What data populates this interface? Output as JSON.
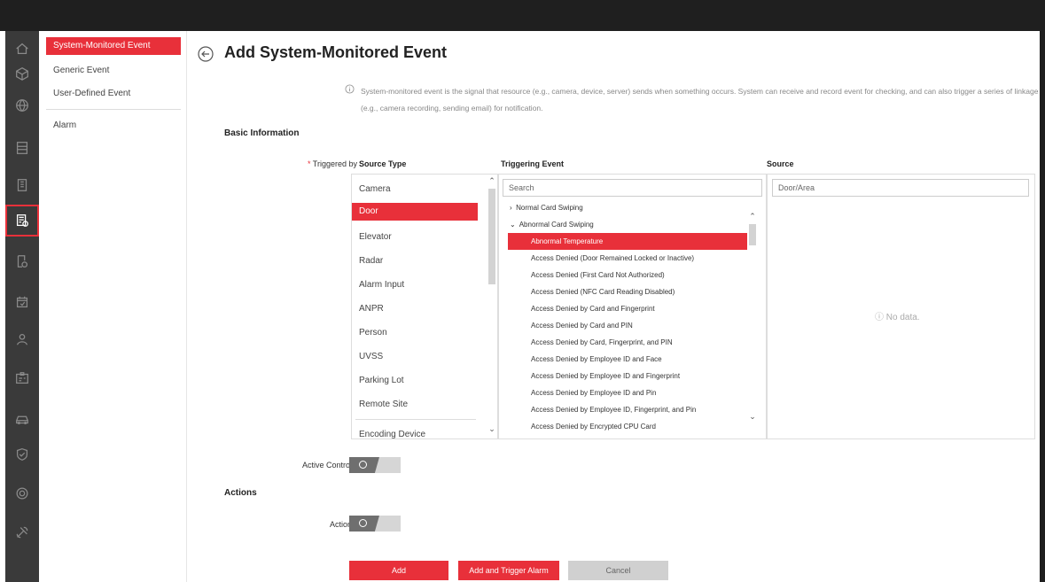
{
  "rail": {
    "icons": [
      "home-icon",
      "cube-icon",
      "globe-icon",
      "storage-icon",
      "building-icon",
      "event-rule-icon",
      "document-clock-icon",
      "calendar-icon",
      "person-icon",
      "badge-icon",
      "vehicle-icon",
      "shield-icon",
      "settings-icon",
      "tools-icon"
    ],
    "active_icon": "event-rule-icon"
  },
  "subnav": {
    "items": [
      "System-Monitored Event",
      "Generic Event",
      "User-Defined Event",
      "Alarm"
    ],
    "active": "System-Monitored Event"
  },
  "page": {
    "title": "Add System-Monitored Event",
    "info_line1": "System-monitored event is the signal that resource (e.g., camera, device, server) sends when something occurs. System can receive and record event for checking, and can also trigger a series of linkage",
    "info_line2": "(e.g., camera recording, sending email) for notification."
  },
  "basic_info": {
    "section_title": "Basic Information",
    "triggered_by_label": "Triggered by",
    "required_mark": "*",
    "source_type_header": "Source Type",
    "triggering_event_header": "Triggering Event",
    "source_header": "Source",
    "source_types": [
      "Camera",
      "Door",
      "Elevator",
      "Radar",
      "Alarm Input",
      "ANPR",
      "Person",
      "UVSS",
      "Parking Lot",
      "Remote Site",
      "Encoding Device"
    ],
    "selected_source_type": "Door",
    "event_search_placeholder": "Search",
    "event_groups": [
      {
        "label": "Normal Card Swiping",
        "expanded": false
      },
      {
        "label": "Abnormal Card Swiping",
        "expanded": true
      }
    ],
    "events": [
      "Abnormal Temperature",
      "Access Denied (Door Remained Locked or Inactive)",
      "Access Denied (First Card Not Authorized)",
      "Access Denied (NFC Card Reading Disabled)",
      "Access Denied by Card and Fingerprint",
      "Access Denied by Card and PIN",
      "Access Denied by Card, Fingerprint, and PIN",
      "Access Denied by Employee ID and Face",
      "Access Denied by Employee ID and Fingerprint",
      "Access Denied by Employee ID and Pin",
      "Access Denied by Employee ID, Fingerprint, and Pin",
      "Access Denied by Encrypted CPU Card"
    ],
    "selected_event": "Abnormal Temperature",
    "source_search_placeholder": "Door/Area",
    "no_data_text": "No data.",
    "active_control_label": "Active Control",
    "active_control_on": false
  },
  "actions": {
    "section_title": "Actions",
    "action_label": "Action",
    "action_on": false
  },
  "buttons": {
    "add": "Add",
    "add_trigger": "Add and Trigger Alarm",
    "cancel": "Cancel"
  },
  "colors": {
    "accent": "#e8303a",
    "rail_bg": "#3a3a3a",
    "topbar_bg": "#1f1f1f"
  }
}
